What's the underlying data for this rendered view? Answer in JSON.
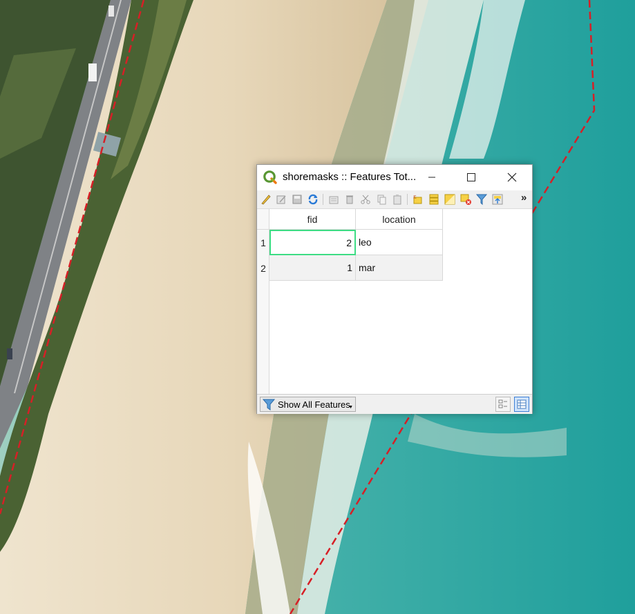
{
  "map": {
    "description_free": true,
    "colors": {
      "vegetation": "#3e5430",
      "road": "#7f8286",
      "sand": "#ece0c8",
      "sea": "#2aa6a3",
      "boundary": "#d71f26"
    }
  },
  "window": {
    "title": "shoremasks :: Features Tot...",
    "buttons": {
      "minimize": "minimize-icon",
      "maximize": "maximize-icon",
      "close": "close-icon"
    }
  },
  "toolbar": {
    "icons": [
      "pencil-icon",
      "multi-edit-icon",
      "save-edits-icon",
      "reload-icon",
      "add-feature-icon",
      "delete-icon",
      "cut-icon",
      "copy-icon",
      "paste-icon",
      "select-expression-icon",
      "select-all-icon",
      "invert-selection-icon",
      "deselect-icon",
      "filter-icon",
      "move-to-top-icon"
    ],
    "more": "»"
  },
  "table": {
    "columns": [
      "fid",
      "location"
    ],
    "rows": [
      {
        "header": "1",
        "fid": "2",
        "location": "leo"
      },
      {
        "header": "2",
        "fid": "1",
        "location": "mar"
      }
    ]
  },
  "status": {
    "filter_label": "Show All Features",
    "form_view_icon": "form-view-icon",
    "table_view_icon": "table-view-icon"
  }
}
